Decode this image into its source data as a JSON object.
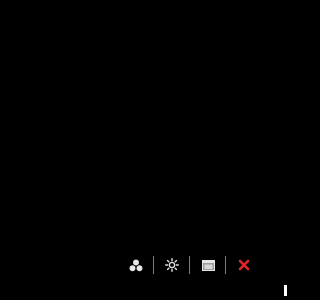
{
  "toolbar": {
    "buttons": [
      {
        "icon": "color-circles-icon"
      },
      {
        "icon": "brightness-icon"
      },
      {
        "icon": "window-icon"
      },
      {
        "icon": "close-icon"
      }
    ]
  },
  "colors": {
    "background": "#000000",
    "icon": "#e6e6e6",
    "separator": "#7a7a7a",
    "close": "#e0262b"
  }
}
